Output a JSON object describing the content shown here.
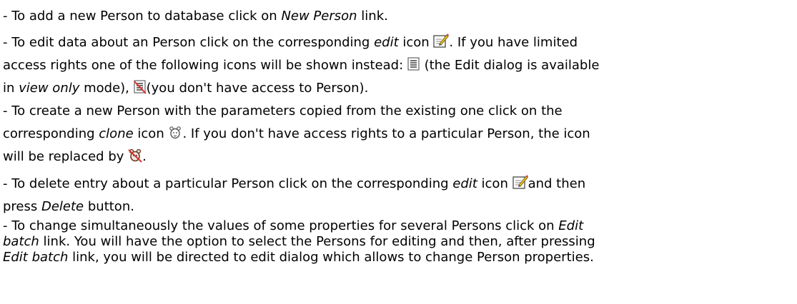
{
  "items": {
    "new_person": {
      "prefix": "- To add a new Person to database click on ",
      "link": "New Person",
      "suffix": " link."
    },
    "edit": {
      "l1_prefix": "- To edit data about an Person click on the corresponding ",
      "l1_em": "edit",
      "l1_mid": " icon ",
      "l1_suffix": ". If you have limited",
      "l2": "access rights one of the following icons will be shown instead: ",
      "l2_suffix": " (the Edit dialog is available",
      "l3_prefix": "in ",
      "l3_em": "view only",
      "l3_mid": " mode), ",
      "l3_suffix": "(you don't have access to Person)."
    },
    "clone": {
      "l1": "- To create a new Person with the parameters copied from the existing one click on the",
      "l2_prefix": "corresponding ",
      "l2_em": "clone",
      "l2_mid": " icon ",
      "l2_suffix": ". If you don't have access rights to a particular Person, the icon",
      "l3_prefix": "will be replaced by ",
      "l3_suffix": "."
    },
    "delete": {
      "l1_prefix": "- To delete entry about a particular Person click on the corresponding ",
      "l1_em": "edit",
      "l1_mid": " icon ",
      "l1_suffix": "and then",
      "l2_prefix": "press ",
      "l2_em": "Delete",
      "l2_suffix": " button."
    },
    "batch": {
      "l1_prefix": "- To change simultaneously the values of some properties for several Persons click on ",
      "l1_em": "Edit",
      "l2_em": "batch",
      "l2_suffix": " link. You will have the option to select the Persons for editing and then, after pressing",
      "l3_em": "Edit batch",
      "l3_suffix": " link, you will be directed to edit dialog which allows to change Person properties."
    }
  },
  "icons": {
    "edit": "edit-pencil-icon",
    "view_only": "view-only-icon",
    "no_access": "no-access-icon",
    "clone": "clone-icon",
    "clone_denied": "clone-denied-icon"
  }
}
